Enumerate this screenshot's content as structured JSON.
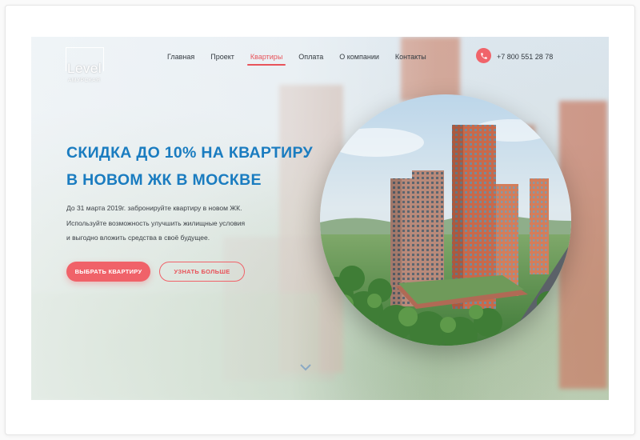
{
  "header": {
    "logo": {
      "word": "Level",
      "sub": "АМУРСКАЯ"
    },
    "nav": [
      {
        "label": "Главная",
        "active": false
      },
      {
        "label": "Проект",
        "active": false
      },
      {
        "label": "Квартиры",
        "active": true
      },
      {
        "label": "Оплата",
        "active": false
      },
      {
        "label": "О компании",
        "active": false
      },
      {
        "label": "Контакты",
        "active": false
      }
    ],
    "phone": "+7 800 551 28 78"
  },
  "hero": {
    "headline_line1": "СКИДКА ДО 10% НА КВАРТИРУ",
    "headline_line2": "В НОВОМ ЖК В МОСКВЕ",
    "desc_line1": "До 31 марта 2019г. забронируйте квартиру в новом ЖК.",
    "desc_line2": "Используйте возможность улучшить жилищные условия",
    "desc_line3": "и выгодно вложить средства в своё будущее.",
    "primary_button": "ВЫБРАТЬ КВАРТИРУ",
    "secondary_button": "УЗНАТЬ БОЛЬШЕ"
  },
  "colors": {
    "accent": "#f06269",
    "headline": "#1a7cc0",
    "text": "#333a40"
  },
  "icons": {
    "phone": "phone-icon",
    "scroll": "chevron-down-icon"
  }
}
